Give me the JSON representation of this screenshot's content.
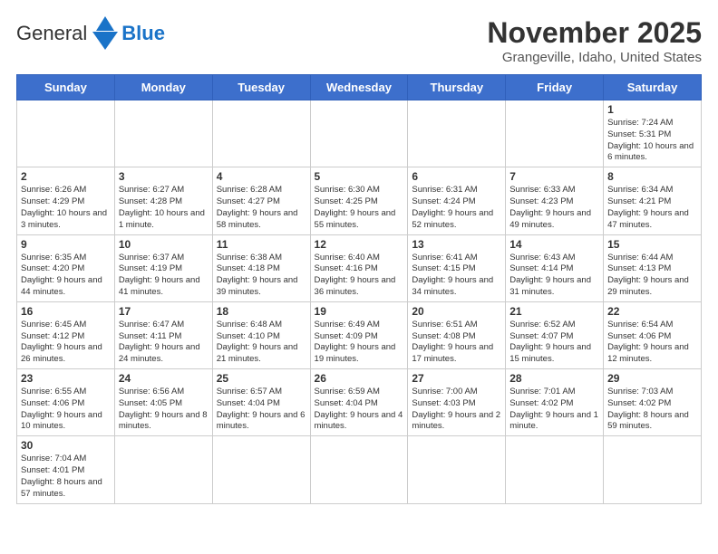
{
  "logo": {
    "text_general": "General",
    "text_blue": "Blue"
  },
  "title": "November 2025",
  "subtitle": "Grangeville, Idaho, United States",
  "days_of_week": [
    "Sunday",
    "Monday",
    "Tuesday",
    "Wednesday",
    "Thursday",
    "Friday",
    "Saturday"
  ],
  "weeks": [
    [
      {
        "day": null,
        "info": null
      },
      {
        "day": null,
        "info": null
      },
      {
        "day": null,
        "info": null
      },
      {
        "day": null,
        "info": null
      },
      {
        "day": null,
        "info": null
      },
      {
        "day": null,
        "info": null
      },
      {
        "day": "1",
        "info": "Sunrise: 7:24 AM\nSunset: 5:31 PM\nDaylight: 10 hours\nand 6 minutes."
      }
    ],
    [
      {
        "day": "2",
        "info": "Sunrise: 6:26 AM\nSunset: 4:29 PM\nDaylight: 10 hours\nand 3 minutes."
      },
      {
        "day": "3",
        "info": "Sunrise: 6:27 AM\nSunset: 4:28 PM\nDaylight: 10 hours\nand 1 minute."
      },
      {
        "day": "4",
        "info": "Sunrise: 6:28 AM\nSunset: 4:27 PM\nDaylight: 9 hours\nand 58 minutes."
      },
      {
        "day": "5",
        "info": "Sunrise: 6:30 AM\nSunset: 4:25 PM\nDaylight: 9 hours\nand 55 minutes."
      },
      {
        "day": "6",
        "info": "Sunrise: 6:31 AM\nSunset: 4:24 PM\nDaylight: 9 hours\nand 52 minutes."
      },
      {
        "day": "7",
        "info": "Sunrise: 6:33 AM\nSunset: 4:23 PM\nDaylight: 9 hours\nand 49 minutes."
      },
      {
        "day": "8",
        "info": "Sunrise: 6:34 AM\nSunset: 4:21 PM\nDaylight: 9 hours\nand 47 minutes."
      }
    ],
    [
      {
        "day": "9",
        "info": "Sunrise: 6:35 AM\nSunset: 4:20 PM\nDaylight: 9 hours\nand 44 minutes."
      },
      {
        "day": "10",
        "info": "Sunrise: 6:37 AM\nSunset: 4:19 PM\nDaylight: 9 hours\nand 41 minutes."
      },
      {
        "day": "11",
        "info": "Sunrise: 6:38 AM\nSunset: 4:18 PM\nDaylight: 9 hours\nand 39 minutes."
      },
      {
        "day": "12",
        "info": "Sunrise: 6:40 AM\nSunset: 4:16 PM\nDaylight: 9 hours\nand 36 minutes."
      },
      {
        "day": "13",
        "info": "Sunrise: 6:41 AM\nSunset: 4:15 PM\nDaylight: 9 hours\nand 34 minutes."
      },
      {
        "day": "14",
        "info": "Sunrise: 6:43 AM\nSunset: 4:14 PM\nDaylight: 9 hours\nand 31 minutes."
      },
      {
        "day": "15",
        "info": "Sunrise: 6:44 AM\nSunset: 4:13 PM\nDaylight: 9 hours\nand 29 minutes."
      }
    ],
    [
      {
        "day": "16",
        "info": "Sunrise: 6:45 AM\nSunset: 4:12 PM\nDaylight: 9 hours\nand 26 minutes."
      },
      {
        "day": "17",
        "info": "Sunrise: 6:47 AM\nSunset: 4:11 PM\nDaylight: 9 hours\nand 24 minutes."
      },
      {
        "day": "18",
        "info": "Sunrise: 6:48 AM\nSunset: 4:10 PM\nDaylight: 9 hours\nand 21 minutes."
      },
      {
        "day": "19",
        "info": "Sunrise: 6:49 AM\nSunset: 4:09 PM\nDaylight: 9 hours\nand 19 minutes."
      },
      {
        "day": "20",
        "info": "Sunrise: 6:51 AM\nSunset: 4:08 PM\nDaylight: 9 hours\nand 17 minutes."
      },
      {
        "day": "21",
        "info": "Sunrise: 6:52 AM\nSunset: 4:07 PM\nDaylight: 9 hours\nand 15 minutes."
      },
      {
        "day": "22",
        "info": "Sunrise: 6:54 AM\nSunset: 4:06 PM\nDaylight: 9 hours\nand 12 minutes."
      }
    ],
    [
      {
        "day": "23",
        "info": "Sunrise: 6:55 AM\nSunset: 4:06 PM\nDaylight: 9 hours\nand 10 minutes."
      },
      {
        "day": "24",
        "info": "Sunrise: 6:56 AM\nSunset: 4:05 PM\nDaylight: 9 hours\nand 8 minutes."
      },
      {
        "day": "25",
        "info": "Sunrise: 6:57 AM\nSunset: 4:04 PM\nDaylight: 9 hours\nand 6 minutes."
      },
      {
        "day": "26",
        "info": "Sunrise: 6:59 AM\nSunset: 4:04 PM\nDaylight: 9 hours\nand 4 minutes."
      },
      {
        "day": "27",
        "info": "Sunrise: 7:00 AM\nSunset: 4:03 PM\nDaylight: 9 hours\nand 2 minutes."
      },
      {
        "day": "28",
        "info": "Sunrise: 7:01 AM\nSunset: 4:02 PM\nDaylight: 9 hours\nand 1 minute."
      },
      {
        "day": "29",
        "info": "Sunrise: 7:03 AM\nSunset: 4:02 PM\nDaylight: 8 hours\nand 59 minutes."
      }
    ],
    [
      {
        "day": "30",
        "info": "Sunrise: 7:04 AM\nSunset: 4:01 PM\nDaylight: 8 hours\nand 57 minutes."
      },
      {
        "day": null,
        "info": null
      },
      {
        "day": null,
        "info": null
      },
      {
        "day": null,
        "info": null
      },
      {
        "day": null,
        "info": null
      },
      {
        "day": null,
        "info": null
      },
      {
        "day": null,
        "info": null
      }
    ]
  ]
}
